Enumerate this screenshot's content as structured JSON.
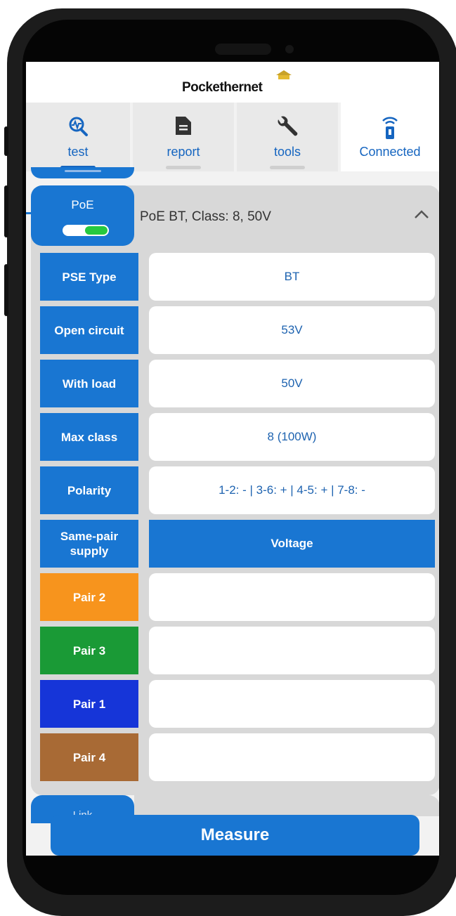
{
  "app": {
    "brand": "Pockethernet"
  },
  "tabs": [
    {
      "label": "test",
      "icon": "test-icon",
      "active": true
    },
    {
      "label": "report",
      "icon": "report-icon",
      "active": false
    },
    {
      "label": "tools",
      "icon": "wrench-icon",
      "active": false
    },
    {
      "label": "Connected",
      "icon": "device-connected-icon",
      "active": false
    }
  ],
  "poe": {
    "tab_label": "PoE",
    "enabled": true,
    "summary": "PoE BT, Class: 8, 50V",
    "rows": [
      {
        "label": "PSE Type",
        "value": "BT",
        "label_color": "#1976d2"
      },
      {
        "label": "Open circuit",
        "value": "53V",
        "label_color": "#1976d2"
      },
      {
        "label": "With load",
        "value": "50V",
        "label_color": "#1976d2"
      },
      {
        "label": "Max class",
        "value": "8 (100W)",
        "label_color": "#1976d2"
      },
      {
        "label": "Polarity",
        "value": "1-2: - | 3-6: + | 4-5: + | 7-8: -",
        "label_color": "#1976d2"
      },
      {
        "label": "Same-pair supply",
        "value": "Voltage",
        "label_color": "#1976d2"
      },
      {
        "label": "Pair 2",
        "value": "",
        "label_color": "#f7941d"
      },
      {
        "label": "Pair 3",
        "value": "",
        "label_color": "#1a9a36"
      },
      {
        "label": "Pair 1",
        "value": "",
        "label_color": "#1635d8"
      },
      {
        "label": "Pair 4",
        "value": "",
        "label_color": "#a86a35"
      }
    ]
  },
  "next_section": {
    "label": "Link"
  },
  "measure_button": {
    "label": "Measure"
  },
  "colors": {
    "accent": "#1976d2",
    "value_text": "#1e63b0"
  }
}
